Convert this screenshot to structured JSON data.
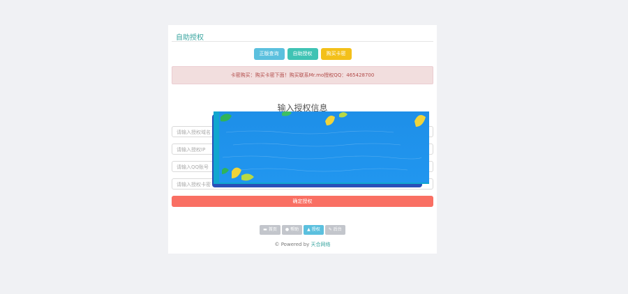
{
  "panel": {
    "title": "自助授权"
  },
  "buttons": {
    "query": "正版查询",
    "auth": "自助授权",
    "buy": "购买卡密"
  },
  "alert": {
    "text": "卡密购买：购买卡密下面！购买联系Mr.mo授权QQ：465428700"
  },
  "form": {
    "heading": "输入授权信息",
    "fields": [
      {
        "placeholder": "请输入授权域名"
      },
      {
        "placeholder": "请输入授权IP"
      },
      {
        "placeholder": "请输入QQ账号"
      },
      {
        "placeholder": "请输入授权卡密"
      }
    ],
    "submit": "确定授权"
  },
  "nav": [
    {
      "glyph": "▬",
      "label": "首页",
      "icon": "home-icon"
    },
    {
      "glyph": "●",
      "label": "帮助",
      "icon": "help-icon"
    },
    {
      "glyph": "▲",
      "label": "授权",
      "icon": "user-icon"
    },
    {
      "glyph": "✎",
      "label": "后台",
      "icon": "edit-icon"
    }
  ],
  "footer": {
    "prefix": "© Powered by ",
    "brand": "天合网络"
  },
  "colors": {
    "accent": "#3aa5a0",
    "info": "#5bc0de",
    "warning": "#f3c01a",
    "danger": "#f96f63",
    "overlay_blue": "#1f93ea"
  }
}
